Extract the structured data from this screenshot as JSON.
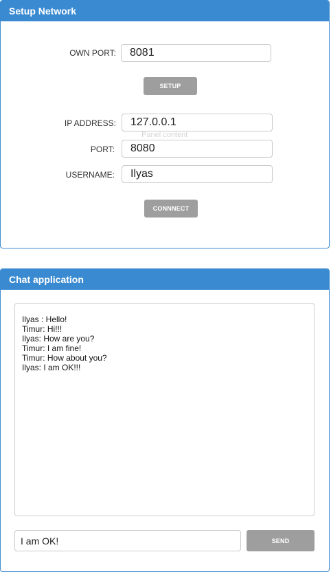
{
  "setup": {
    "title": "Setup Network",
    "own_port_label": "OWN PORT:",
    "own_port_value": "8081",
    "setup_button": "SETUP",
    "ip_label": "IP ADDRESS:",
    "ip_value": "127.0.0.1",
    "ghost_text": "Panel content",
    "port_label": "PORT:",
    "port_value": "8080",
    "username_label": "USERNAME:",
    "username_value": "Ilyas",
    "connect_button": "CONNNECT"
  },
  "chat": {
    "title": "Chat application",
    "messages": [
      "Ilyas : Hello!",
      "Timur: Hi!!!",
      "Ilyas: How are you?",
      "Timur: I am fine!",
      "Timur: How about you?",
      "Ilyas: I am OK!!!"
    ],
    "input_value": "I am OK!",
    "send_button": "SEND"
  },
  "colors": {
    "header_bg": "#3a8ad1",
    "button_bg": "#9e9e9e"
  }
}
